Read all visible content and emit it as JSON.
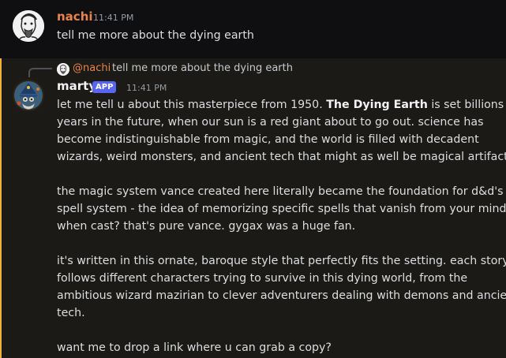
{
  "message1": {
    "username": "nachi",
    "timestamp": "11:41 PM",
    "text": "tell me more about the dying earth",
    "avatar_icon": "sketch-portrait-avatar"
  },
  "message2": {
    "reply": {
      "mention": "@nachi",
      "text": "tell me more about the dying earth"
    },
    "username": "marty",
    "badge": "APP",
    "timestamp": "11:41 PM",
    "avatar_icon": "wizard-avatar",
    "paragraphs": {
      "p1": {
        "l1_pre": "let me tell u about this masterpiece from 1950. ",
        "l1_bold": "The Dying Earth",
        "l1_post": " is set billions of",
        "l2": "years in the future, when our sun is a red giant about to go out. science has",
        "l3": "become indistinguishable from magic, and the world is filled with decadent",
        "l4": "wizards, weird monsters, and ancient tech that might as well be magical artifacts."
      },
      "p2": {
        "l1": "the magic system vance created here literally became the foundation for d&d's",
        "l2": "spell system - the idea of memorizing specific spells that vanish from your mind",
        "l3": "when cast? that's pure vance. gygax was a huge fan."
      },
      "p3": {
        "l1": "it's written in this ornate, baroque style that perfectly fits the setting. each story",
        "l2": "follows different characters trying to survive in this dying world, from the",
        "l3": "ambitious wizard mazirian to clever adventurers dealing with demons and ancient",
        "l4": "tech."
      },
      "p4": {
        "l1": "want me to drop a link where u can grab a copy?"
      }
    }
  },
  "colors": {
    "accent_bar": "#f0b232",
    "username_nachi": "#e8844a",
    "badge_bg": "#5865f2"
  }
}
